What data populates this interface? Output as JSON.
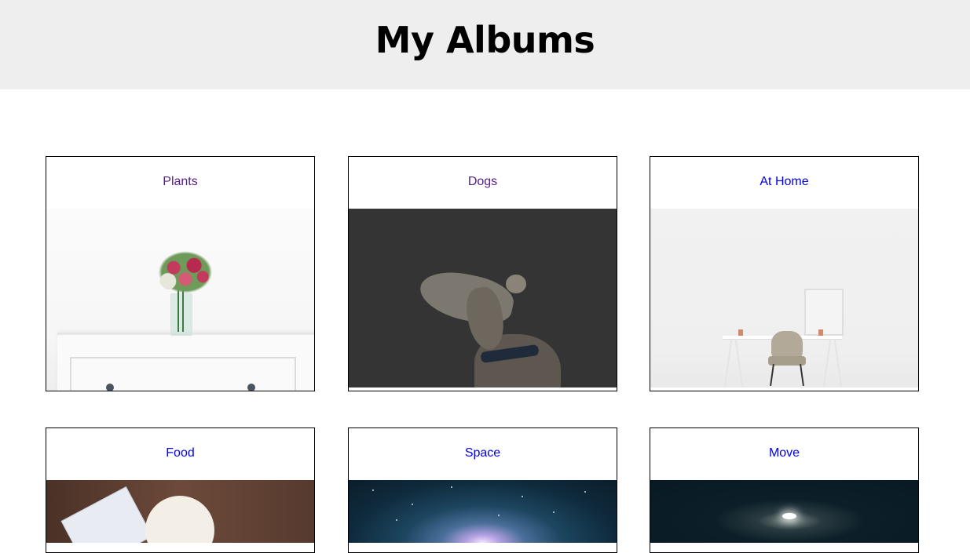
{
  "header": {
    "title": "My Albums"
  },
  "albums": [
    {
      "label": "Plants",
      "photo": "white dresser with flower vase",
      "link_state": "visited"
    },
    {
      "label": "Dogs",
      "photo": "grey dog on dark background",
      "link_state": "visited"
    },
    {
      "label": "At Home",
      "photo": "desk and chair in white room",
      "link_state": "unvisited"
    },
    {
      "label": "Food",
      "photo": "plate of food on wooden table",
      "link_state": "unvisited"
    },
    {
      "label": "Space",
      "photo": "starry sky with glowing light",
      "link_state": "unvisited"
    },
    {
      "label": "Move",
      "photo": "light in dark landscape",
      "link_state": "unvisited"
    }
  ],
  "colors": {
    "header_bg": "#eeeeee",
    "link_unvisited": "#0000ee",
    "link_visited": "#551a8b",
    "card_border": "#000000"
  }
}
